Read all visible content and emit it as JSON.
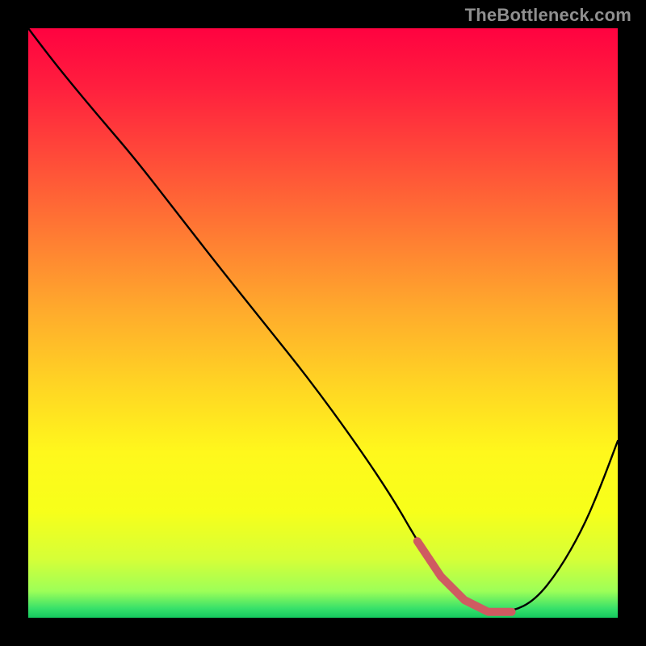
{
  "watermark": "TheBottleneck.com",
  "colors": {
    "frame": "#000000",
    "curve": "#000000",
    "highlight": "#cf5b61",
    "gradient_stops": [
      {
        "offset": 0.0,
        "color": "#ff0240"
      },
      {
        "offset": 0.1,
        "color": "#ff1f3e"
      },
      {
        "offset": 0.22,
        "color": "#ff4b39"
      },
      {
        "offset": 0.35,
        "color": "#ff7b33"
      },
      {
        "offset": 0.48,
        "color": "#ffab2c"
      },
      {
        "offset": 0.6,
        "color": "#ffd324"
      },
      {
        "offset": 0.72,
        "color": "#fff81c"
      },
      {
        "offset": 0.82,
        "color": "#f7ff1a"
      },
      {
        "offset": 0.9,
        "color": "#d6ff37"
      },
      {
        "offset": 0.955,
        "color": "#9dff58"
      },
      {
        "offset": 0.985,
        "color": "#35e06a"
      },
      {
        "offset": 1.0,
        "color": "#14c95e"
      }
    ]
  },
  "chart_data": {
    "type": "line",
    "title": "",
    "xlabel": "",
    "ylabel": "",
    "xlim": [
      0,
      100
    ],
    "ylim": [
      0,
      100
    ],
    "series": [
      {
        "name": "curve",
        "x": [
          0,
          3,
          7,
          12,
          18,
          25,
          32,
          40,
          48,
          56,
          62,
          66,
          70,
          74,
          78,
          82,
          86,
          90,
          94,
          97,
          100
        ],
        "values": [
          100,
          96,
          91,
          85,
          78,
          69,
          60,
          50,
          40,
          29,
          20,
          13,
          7,
          3,
          1,
          1,
          3,
          8,
          15,
          22,
          30
        ]
      }
    ],
    "highlight_segment": {
      "series": "curve",
      "x_start": 66,
      "x_end": 82,
      "comment": "pink thick segment near the minimum"
    }
  }
}
